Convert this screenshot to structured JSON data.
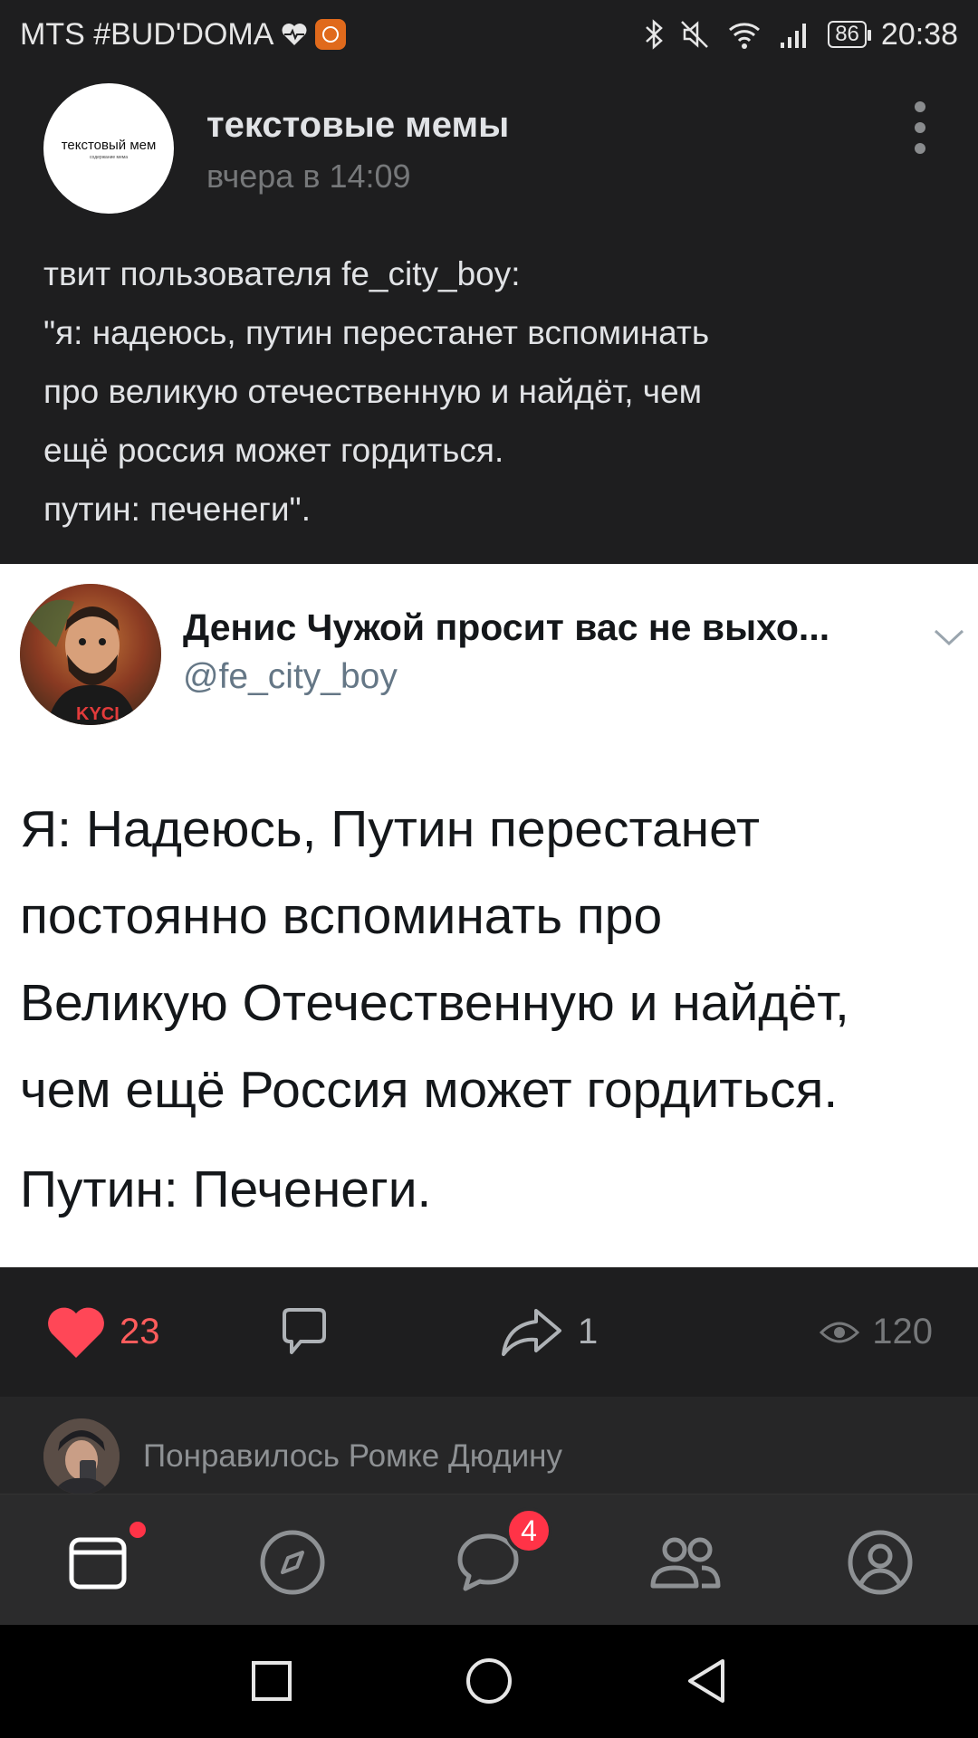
{
  "status_bar": {
    "carrier": "MTS #BUD'DOMA",
    "battery": "86",
    "time": "20:38"
  },
  "post": {
    "group_name": "текстовые мемы",
    "group_avatar_text": "текстовый мем",
    "group_avatar_subtext": "содержание мема",
    "time": "вчера в 14:09",
    "text_lines": [
      "твит пользователя fe_city_boy:",
      "\"я: надеюсь, путин перестанет вспоминать",
      "про великую отечественную и найдёт, чем",
      "ещё россия может гордиться.",
      "путин: печенеги\"."
    ]
  },
  "tweet": {
    "author_name": "Денис Чужой просит вас не выхо...",
    "handle": "@fe_city_boy",
    "shirt_text": "KYCI",
    "body_lines": [
      "Я: Надеюсь, Путин перестанет",
      "постоянно вспоминать про",
      "Великую Отечественную и найдёт,",
      "чем ещё Россия может гордиться."
    ],
    "body_last": "Путин: Печенеги."
  },
  "actions": {
    "likes": "23",
    "shares": "1",
    "views": "120"
  },
  "liked_by": {
    "text": "Понравилось Ромке Дюдину"
  },
  "tab_bar": {
    "messages_badge": "4"
  },
  "colors": {
    "background": "#1e1e1f",
    "like_red": "#ff5c5c",
    "badge_red": "#ff3347",
    "muted": "#76787a"
  },
  "icons": [
    "heart-icon",
    "comment-icon",
    "share-icon",
    "eye-icon",
    "news-tab-icon",
    "compass-icon",
    "messages-icon",
    "friends-icon",
    "profile-icon"
  ]
}
